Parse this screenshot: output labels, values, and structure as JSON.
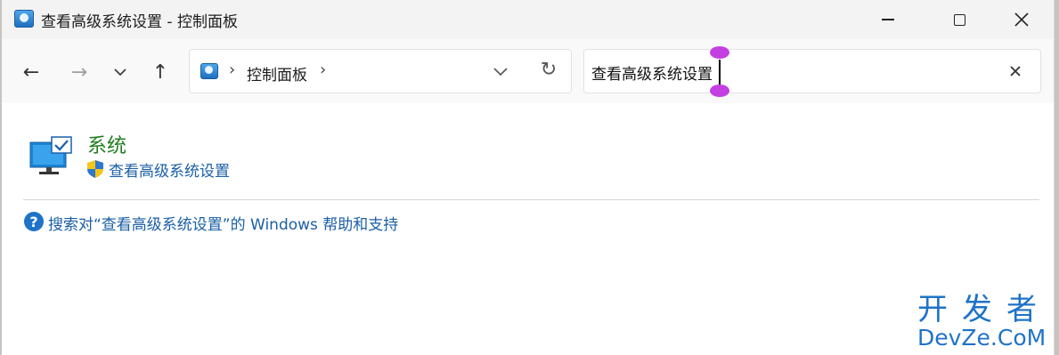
{
  "window": {
    "title": "查看高级系统设置 - 控制面板",
    "minimize_glyph": "—",
    "maximize_glyph": "☐",
    "close_glyph": "✕"
  },
  "nav": {
    "back_glyph": "←",
    "forward_glyph": "→",
    "recent_glyph": "⌄",
    "up_glyph": "↑"
  },
  "address": {
    "icon": "control-panel-icon",
    "separator": "›",
    "path": "控制面板",
    "dropdown_glyph": "⌄",
    "refresh_glyph": "↻"
  },
  "search": {
    "value": "查看高级系统设置",
    "clear_glyph": "✕"
  },
  "results": [
    {
      "icon": "monitor-icon",
      "title": "系统",
      "link_icon": "uac-shield-icon",
      "link": "查看高级系统设置"
    }
  ],
  "help": {
    "icon": "help-icon",
    "glyph": "?",
    "link": "搜索对“查看高级系统设置”的 Windows 帮助和支持"
  },
  "watermark": {
    "line1": "开发者",
    "line2": "DevZe.CoM"
  },
  "colors": {
    "title_green": "#1f7d1f",
    "link_blue": "#1a5fa6",
    "selection_handle": "#c43fe2",
    "watermark_blue": "#1f73c8"
  }
}
